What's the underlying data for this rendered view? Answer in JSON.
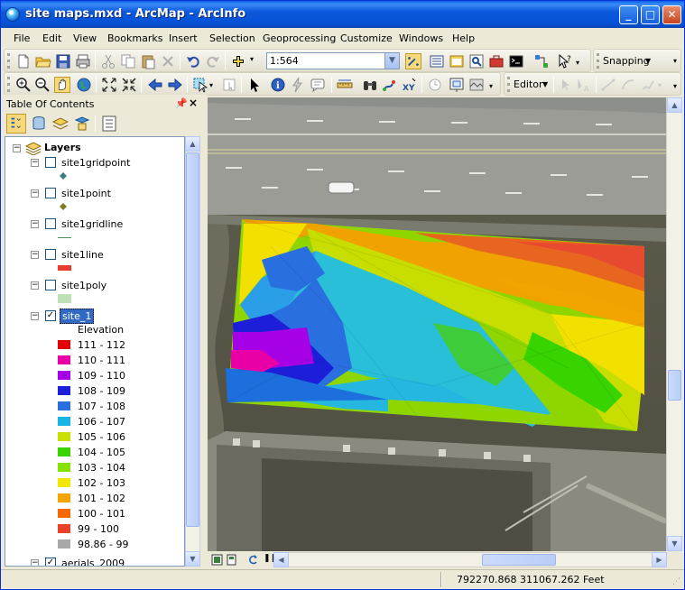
{
  "window": {
    "title": "site maps.mxd - ArcMap - ArcInfo",
    "minimize": "_",
    "maximize": "□",
    "close": "✕"
  },
  "menu": [
    "File",
    "Edit",
    "View",
    "Bookmarks",
    "Insert",
    "Selection",
    "Geoprocessing",
    "Customize",
    "Windows",
    "Help"
  ],
  "toolbar": {
    "scale": "1:564",
    "snapping_label": "Snapping",
    "editor_label": "Editor"
  },
  "toc": {
    "title": "Table Of Contents",
    "root_label": "Layers",
    "layers": [
      {
        "name": "site1gridpoint",
        "checked": false,
        "symbol": "point",
        "color": "#3a7f7d"
      },
      {
        "name": "site1point",
        "checked": false,
        "symbol": "point",
        "color": "#7d7a22"
      },
      {
        "name": "site1gridline",
        "checked": false,
        "symbol": "line",
        "color": "#4b8f52"
      },
      {
        "name": "site1line",
        "checked": false,
        "symbol": "rect",
        "color": "#e83a2d"
      },
      {
        "name": "site1poly",
        "checked": false,
        "symbol": "rect",
        "color": "#bde0b5"
      },
      {
        "name": "site_1",
        "checked": true,
        "symbol": "none",
        "selected": true
      },
      {
        "name": "aerials_2009",
        "checked": true,
        "symbol": "none"
      }
    ],
    "legend_title": "Elevation",
    "legend": [
      {
        "label": "111 - 112",
        "color": "#e30000"
      },
      {
        "label": "110 - 111",
        "color": "#e800a6"
      },
      {
        "label": "109 - 110",
        "color": "#a600e6"
      },
      {
        "label": "108 - 109",
        "color": "#1d1fd8"
      },
      {
        "label": "107 - 108",
        "color": "#2a6fe0"
      },
      {
        "label": "106 - 107",
        "color": "#18b4e4"
      },
      {
        "label": "105 - 106",
        "color": "#c8e000"
      },
      {
        "label": "104 - 105",
        "color": "#38d400"
      },
      {
        "label": "103 - 104",
        "color": "#86e000"
      },
      {
        "label": "102 - 103",
        "color": "#f3e600"
      },
      {
        "label": "101 - 102",
        "color": "#f2a400"
      },
      {
        "label": "100 - 101",
        "color": "#f36b00"
      },
      {
        "label": "99 - 100",
        "color": "#e8432a"
      },
      {
        "label": "98.86 - 99",
        "color": "#a8a8a8"
      }
    ]
  },
  "status": {
    "coordinates": "792270.868  311067.262 Feet"
  }
}
